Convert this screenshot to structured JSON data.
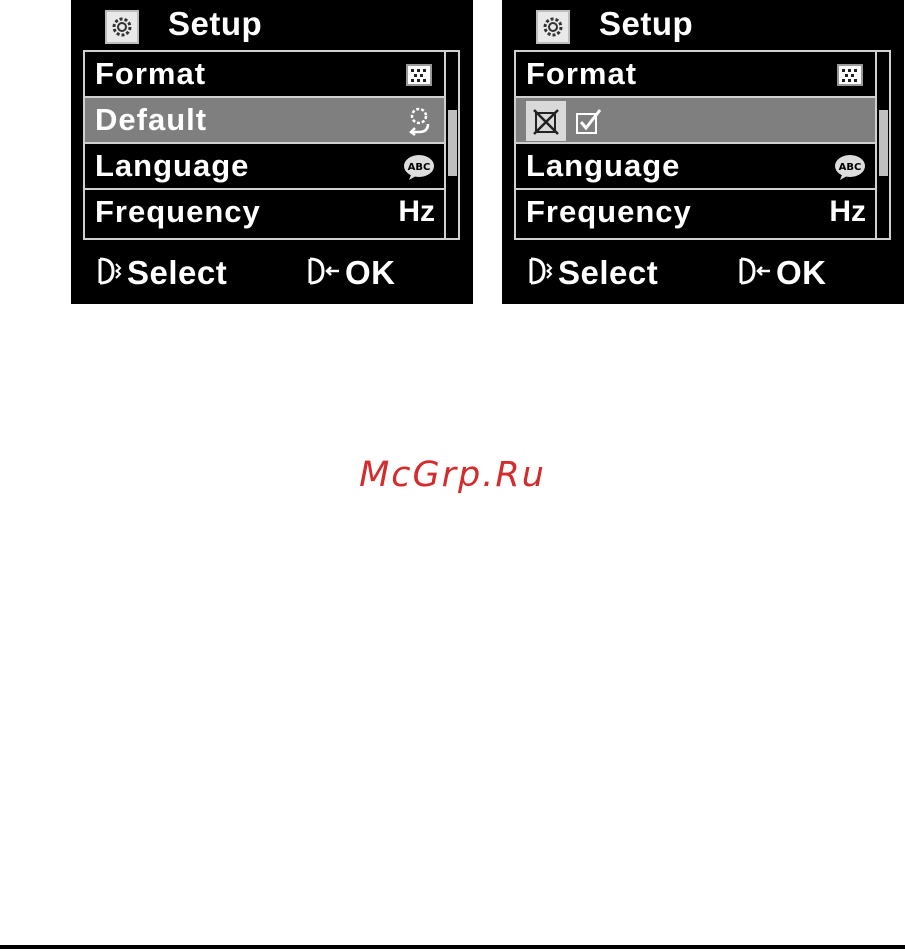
{
  "screens": [
    {
      "title": "Setup",
      "title_icon": "gear-icon",
      "menu": [
        {
          "label": "Format",
          "icon": "format-icon"
        },
        {
          "label": "Default",
          "icon": "default-reset-icon",
          "selected": true
        },
        {
          "label": "Language",
          "icon": "abc-language-icon"
        },
        {
          "label": "Frequency",
          "value": "Hz"
        }
      ],
      "footer": {
        "select_label": "Select",
        "ok_label": "OK"
      }
    },
    {
      "title": "Setup",
      "title_icon": "gear-icon",
      "menu": [
        {
          "label": "Format",
          "icon": "format-icon"
        },
        {
          "confirm": [
            "cancel-icon",
            "confirm-check-icon"
          ],
          "selected": true
        },
        {
          "label": "Language",
          "icon": "abc-language-icon"
        },
        {
          "label": "Frequency",
          "value": "Hz"
        }
      ],
      "footer": {
        "select_label": "Select",
        "ok_label": "OK"
      }
    }
  ],
  "watermark": "McGrp.Ru",
  "colors": {
    "screen_bg": "#000000",
    "highlight": "#7f7f7f",
    "text": "#ffffff",
    "watermark": "#d42c2c"
  }
}
